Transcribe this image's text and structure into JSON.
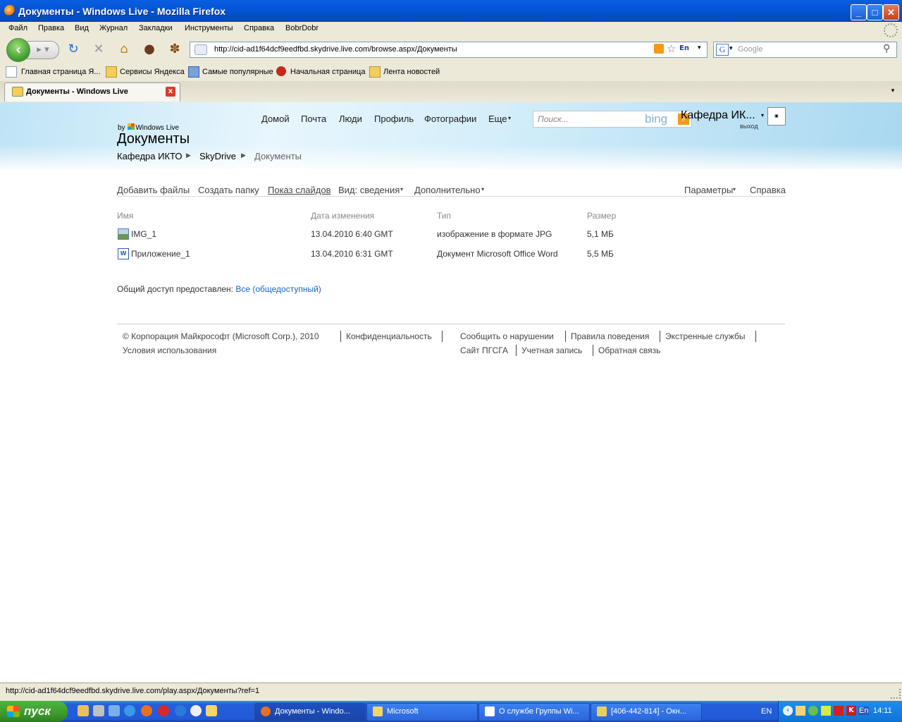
{
  "window": {
    "title": "Документы - Windows Live - Mozilla Firefox"
  },
  "menu": [
    "Файл",
    "Правка",
    "Вид",
    "Журнал",
    "Закладки",
    "Инструменты",
    "Справка",
    "BobrDobr"
  ],
  "address": {
    "url": "http://cid-ad1f64dcf9eedfbd.skydrive.live.com/browse.aspx/Документы",
    "lang_badge": "En"
  },
  "search": {
    "placeholder": "Google",
    "engine_letter": "G"
  },
  "bookmarks": [
    "Главная страница Я...",
    "Сервисы Яндекса",
    "Самые популярные",
    "Начальная страница",
    "Лента новостей"
  ],
  "tab": {
    "label": "Документы - Windows Live"
  },
  "site": {
    "nav": [
      "Домой",
      "Почта",
      "Люди",
      "Профиль",
      "Фотографии",
      "Еще"
    ],
    "search_placeholder": "Поиск...",
    "bing": "bing",
    "user": "Кафедра ИК...",
    "logout": "выход",
    "by_prefix": "by",
    "brand": "Windows Live",
    "page_title": "Документы",
    "breadcrumb": [
      "Кафедра ИКТО",
      "SkyDrive",
      "Документы"
    ],
    "commands": {
      "add_files": "Добавить файлы",
      "create_folder": "Создать папку",
      "slideshow": "Показ слайдов",
      "view": "Вид: сведения",
      "more": "Дополнительно",
      "options": "Параметры",
      "help": "Справка"
    },
    "columns": [
      "Имя",
      "Дата изменения",
      "Тип",
      "Размер"
    ],
    "files": [
      {
        "name": "IMG_1",
        "date": "13.04.2010 6:40 GMT",
        "type": "изображение в формате JPG",
        "size": "5,1 МБ",
        "icon": "image-file-icon"
      },
      {
        "name": "Приложение_1",
        "date": "13.04.2010 6:31 GMT",
        "type": "Документ Microsoft Office Word",
        "size": "5,5 МБ",
        "icon": "word-file-icon"
      }
    ],
    "shared_label": "Общий доступ предоставлен:",
    "shared_link": "Все (общедоступный)",
    "footer": {
      "copyright": "© Корпорация Майкрософт (Microsoft Corp.), 2010",
      "privacy": "Конфиденциальность",
      "terms": "Условия использования",
      "report": "Сообщить о нарушении",
      "conduct": "Правила поведения",
      "emergency": "Экстренные службы",
      "site": "Сайт ПГСГА",
      "account": "Учетная запись",
      "feedback": "Обратная связь"
    }
  },
  "status": {
    "text": "http://cid-ad1f64dcf9eedfbd.skydrive.live.com/play.aspx/Документы?ref=1"
  },
  "taskbar": {
    "start": "пуск",
    "tasks": [
      "Документы - Windo...",
      "Microsoft",
      "О службе Группы Wi...",
      "[406-442-814] - Окн..."
    ],
    "lang": "EN",
    "tray_lang": "En",
    "clock": "14:11"
  },
  "colors": {
    "link": "#1565c0",
    "titlebar": "#0556d6",
    "start": "#3c9a2c"
  }
}
